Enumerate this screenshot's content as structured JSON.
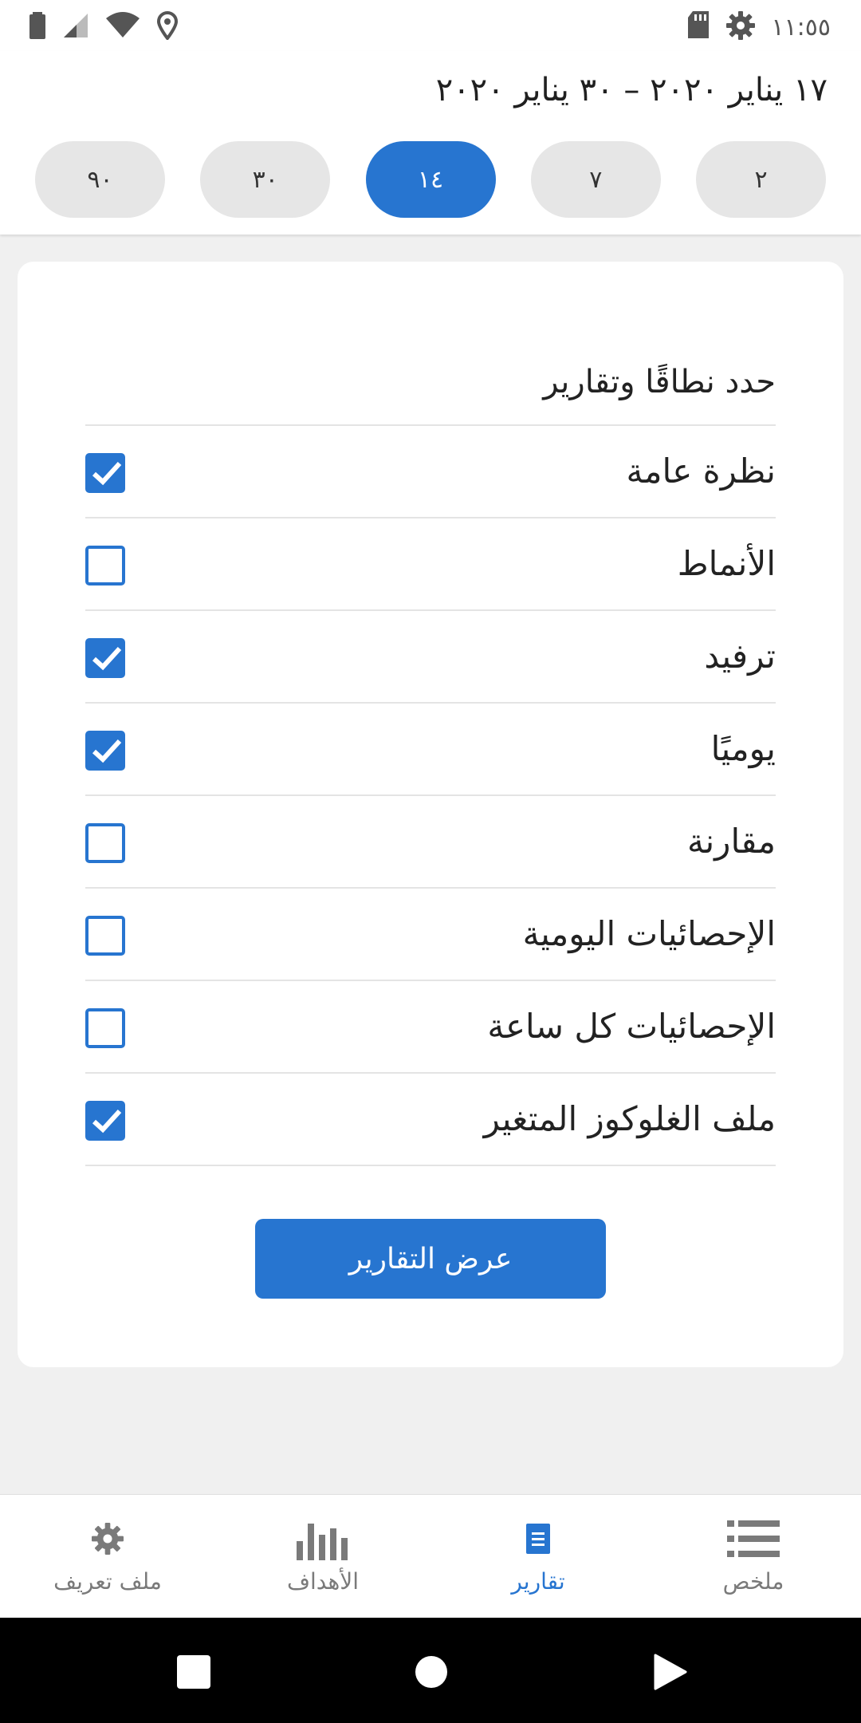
{
  "status_bar": {
    "time": "١١:٥٥",
    "left_icons": [
      "battery-icon",
      "signal-icon",
      "wifi-icon",
      "location-icon"
    ],
    "right_icons": [
      "sd-card-icon",
      "settings-gear-icon"
    ]
  },
  "header": {
    "date_range": "١٧ يناير ٢٠٢٠ – ٣٠ يناير ٢٠٢٠",
    "range_options": [
      {
        "label": "٢",
        "selected": false
      },
      {
        "label": "٧",
        "selected": false
      },
      {
        "label": "١٤",
        "selected": true
      },
      {
        "label": "٣٠",
        "selected": false
      },
      {
        "label": "٩٠",
        "selected": false
      }
    ]
  },
  "card": {
    "title": "حدد نطاقًا وتقارير",
    "reports": [
      {
        "label": "نظرة عامة",
        "checked": true
      },
      {
        "label": "الأنماط",
        "checked": false
      },
      {
        "label": "ترفيد",
        "checked": true
      },
      {
        "label": "يوميًا",
        "checked": true
      },
      {
        "label": "مقارنة",
        "checked": false
      },
      {
        "label": "الإحصائيات اليومية",
        "checked": false
      },
      {
        "label": "الإحصائيات كل ساعة",
        "checked": false
      },
      {
        "label": "ملف الغلوكوز المتغير",
        "checked": true
      }
    ],
    "show_button": "عرض التقارير"
  },
  "bottom_nav": {
    "items": [
      {
        "label": "ملخص",
        "icon": "list-icon",
        "active": false
      },
      {
        "label": "تقارير",
        "icon": "document-icon",
        "active": true
      },
      {
        "label": "الأهداف",
        "icon": "bar-chart-icon",
        "active": false
      },
      {
        "label": "ملف تعريف",
        "icon": "gear-icon",
        "active": false
      }
    ]
  },
  "colors": {
    "accent": "#2775d0",
    "pill_inactive": "#e6e6e6",
    "background": "#f0f0f0"
  }
}
